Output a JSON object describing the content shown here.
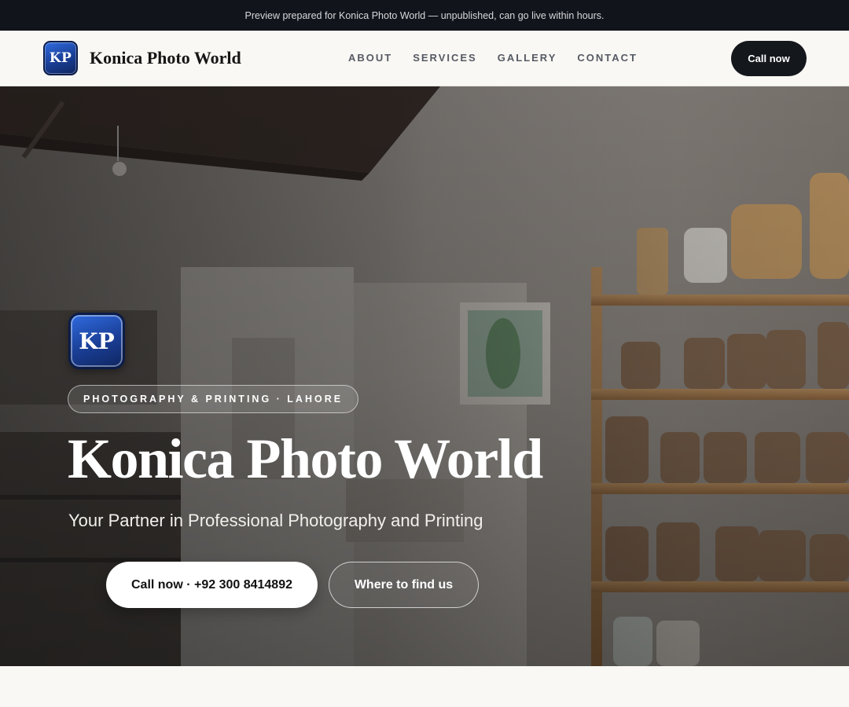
{
  "preview_banner": "Preview prepared for Konica Photo World — unpublished, can go live within hours.",
  "brand": {
    "logo_text": "KP",
    "name": "Konica Photo World"
  },
  "nav": {
    "links": [
      "ABOUT",
      "SERVICES",
      "GALLERY",
      "CONTACT"
    ],
    "cta_label": "Call now"
  },
  "hero": {
    "logo_text": "KP",
    "badge": "PHOTOGRAPHY & PRINTING · LAHORE",
    "title": "Konica Photo World",
    "subtitle": "Your Partner in Professional Photography and Printing",
    "primary_cta": "Call now · +92 300 8414892",
    "secondary_cta": "Where to find us"
  },
  "colors": {
    "topbar_bg": "#11141a",
    "page_bg": "#faf8f4",
    "brand_blue": "#1a3e95",
    "nav_cta_bg": "#14171c"
  }
}
